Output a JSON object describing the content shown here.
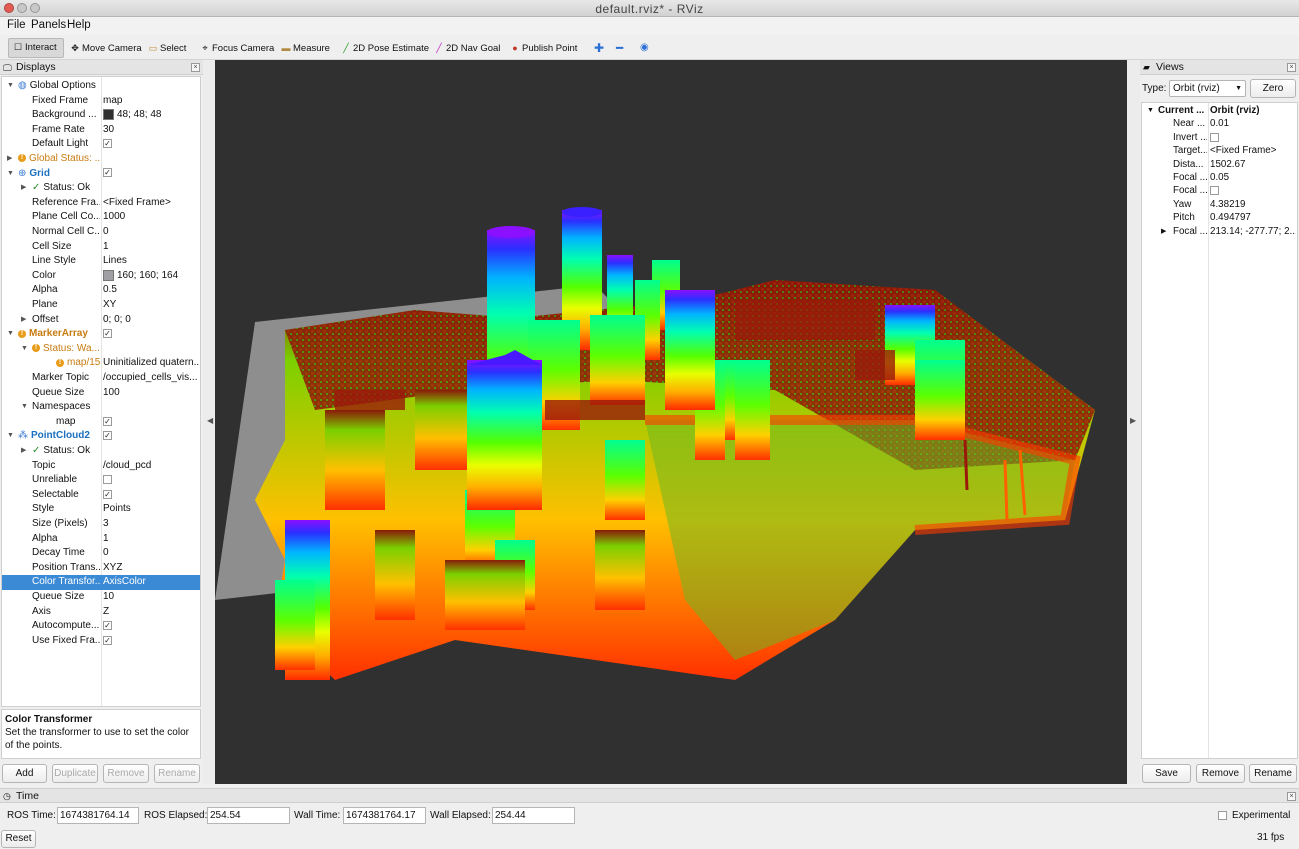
{
  "window": {
    "title": "default.rviz* - RViz"
  },
  "menu": [
    "File",
    "Panels",
    "Help"
  ],
  "toolbar": [
    {
      "label": "Interact",
      "icon": "interact-icon",
      "active": true
    },
    {
      "label": "Move Camera",
      "icon": "move-camera-icon"
    },
    {
      "label": "Select",
      "icon": "select-icon"
    },
    {
      "label": "Focus Camera",
      "icon": "focus-camera-icon"
    },
    {
      "label": "Measure",
      "icon": "measure-icon"
    },
    {
      "label": "2D Pose Estimate",
      "icon": "pose-estimate-icon",
      "color": "#2aa02a"
    },
    {
      "label": "2D Nav Goal",
      "icon": "nav-goal-icon",
      "color": "#c02ac0"
    },
    {
      "label": "Publish Point",
      "icon": "publish-point-icon",
      "color": "#c0392b"
    }
  ],
  "displays": {
    "title": "Displays",
    "rows": [
      {
        "key": "Global Options",
        "indent": 0,
        "arrow": "down",
        "icon": "globe-icon"
      },
      {
        "key": "Fixed Frame",
        "value": "map",
        "indent": 2
      },
      {
        "key": "Background ...",
        "value": "48; 48; 48",
        "indent": 2,
        "swatch": "#303030"
      },
      {
        "key": "Frame Rate",
        "value": "30",
        "indent": 2
      },
      {
        "key": "Default Light",
        "value": "",
        "indent": 2,
        "check": true
      },
      {
        "key": "Global Status: ...",
        "indent": 0,
        "arrow": "right",
        "warn": true,
        "style": "orange"
      },
      {
        "key": "Grid",
        "indent": 0,
        "arrow": "down",
        "icon": "grid-icon",
        "style": "blue",
        "check": true
      },
      {
        "key": "Status: Ok",
        "indent": 1,
        "arrow": "right",
        "ok": true
      },
      {
        "key": "Reference Fra...",
        "value": "<Fixed Frame>",
        "indent": 2
      },
      {
        "key": "Plane Cell Co...",
        "value": "1000",
        "indent": 2
      },
      {
        "key": "Normal Cell C...",
        "value": "0",
        "indent": 2
      },
      {
        "key": "Cell Size",
        "value": "1",
        "indent": 2
      },
      {
        "key": "Line Style",
        "value": "Lines",
        "indent": 2
      },
      {
        "key": "Color",
        "value": "160; 160; 164",
        "indent": 2,
        "swatch": "#a0a0a4"
      },
      {
        "key": "Alpha",
        "value": "0.5",
        "indent": 2
      },
      {
        "key": "Plane",
        "value": "XY",
        "indent": 2
      },
      {
        "key": "Offset",
        "value": "0; 0; 0",
        "indent": 1,
        "arrow": "right"
      },
      {
        "key": "MarkerArray",
        "indent": 0,
        "arrow": "down",
        "warn": true,
        "style": "orange-bold",
        "check": true
      },
      {
        "key": "Status: Wa...",
        "indent": 1,
        "arrow": "down",
        "warn": true,
        "style": "orange"
      },
      {
        "key": "map/15",
        "value": "Uninitialized quatern...",
        "indent": 3,
        "warn": true,
        "style": "orange"
      },
      {
        "key": "Marker Topic",
        "value": "/occupied_cells_vis...",
        "indent": 2
      },
      {
        "key": "Queue Size",
        "value": "100",
        "indent": 2
      },
      {
        "key": "Namespaces",
        "indent": 1,
        "arrow": "down"
      },
      {
        "key": "map",
        "value": "",
        "indent": 3,
        "check": true
      },
      {
        "key": "PointCloud2",
        "indent": 0,
        "arrow": "down",
        "icon": "pointcloud-icon",
        "style": "blue",
        "check": true
      },
      {
        "key": "Status: Ok",
        "indent": 1,
        "arrow": "right",
        "ok": true
      },
      {
        "key": "Topic",
        "value": "/cloud_pcd",
        "indent": 2
      },
      {
        "key": "Unreliable",
        "value": "",
        "indent": 2,
        "check": false
      },
      {
        "key": "Selectable",
        "value": "",
        "indent": 2,
        "check": true
      },
      {
        "key": "Style",
        "value": "Points",
        "indent": 2
      },
      {
        "key": "Size (Pixels)",
        "value": "3",
        "indent": 2
      },
      {
        "key": "Alpha",
        "value": "1",
        "indent": 2
      },
      {
        "key": "Decay Time",
        "value": "0",
        "indent": 2
      },
      {
        "key": "Position Trans...",
        "value": "XYZ",
        "indent": 2
      },
      {
        "key": "Color Transfor...",
        "value": "AxisColor",
        "indent": 2,
        "selected": true
      },
      {
        "key": "Queue Size",
        "value": "10",
        "indent": 2
      },
      {
        "key": "Axis",
        "value": "Z",
        "indent": 2
      },
      {
        "key": "Autocompute...",
        "value": "",
        "indent": 2,
        "check": true
      },
      {
        "key": "Use Fixed Fra...",
        "value": "",
        "indent": 2,
        "check": true
      }
    ],
    "description": {
      "title": "Color Transformer",
      "body": "Set the transformer to use to set the color of the points."
    },
    "buttons": {
      "add": "Add",
      "duplicate": "Duplicate",
      "remove": "Remove",
      "rename": "Rename"
    }
  },
  "views": {
    "title": "Views",
    "type_label": "Type:",
    "type_value": "Orbit (rviz)",
    "zero": "Zero",
    "rows": [
      {
        "key": "Current ...",
        "value": "Orbit (rviz)",
        "bold": true,
        "arrow": "down"
      },
      {
        "key": "Near ...",
        "value": "0.01"
      },
      {
        "key": "Invert ...",
        "value": "",
        "check": false
      },
      {
        "key": "Target...",
        "value": "<Fixed Frame>"
      },
      {
        "key": "Dista...",
        "value": "1502.67"
      },
      {
        "key": "Focal ...",
        "value": "0.05"
      },
      {
        "key": "Focal ...",
        "value": "",
        "check": false
      },
      {
        "key": "Yaw",
        "value": "4.38219"
      },
      {
        "key": "Pitch",
        "value": "0.494797"
      },
      {
        "key": "Focal ...",
        "value": "213.14; -277.77; 2...",
        "arrow": "right"
      }
    ],
    "buttons": {
      "save": "Save",
      "remove": "Remove",
      "rename": "Rename"
    }
  },
  "time": {
    "title": "Time",
    "ros_time_label": "ROS Time:",
    "ros_time": "1674381764.14",
    "ros_elapsed_label": "ROS Elapsed:",
    "ros_elapsed": "254.54",
    "wall_time_label": "Wall Time:",
    "wall_time": "1674381764.17",
    "wall_elapsed_label": "Wall Elapsed:",
    "wall_elapsed": "254.44",
    "experimental": "Experimental",
    "reset": "Reset",
    "fps": "31 fps"
  },
  "colors": {
    "viewport_bg": "#303030",
    "selection": "#3a8ad6",
    "warning": "#e89b18"
  }
}
